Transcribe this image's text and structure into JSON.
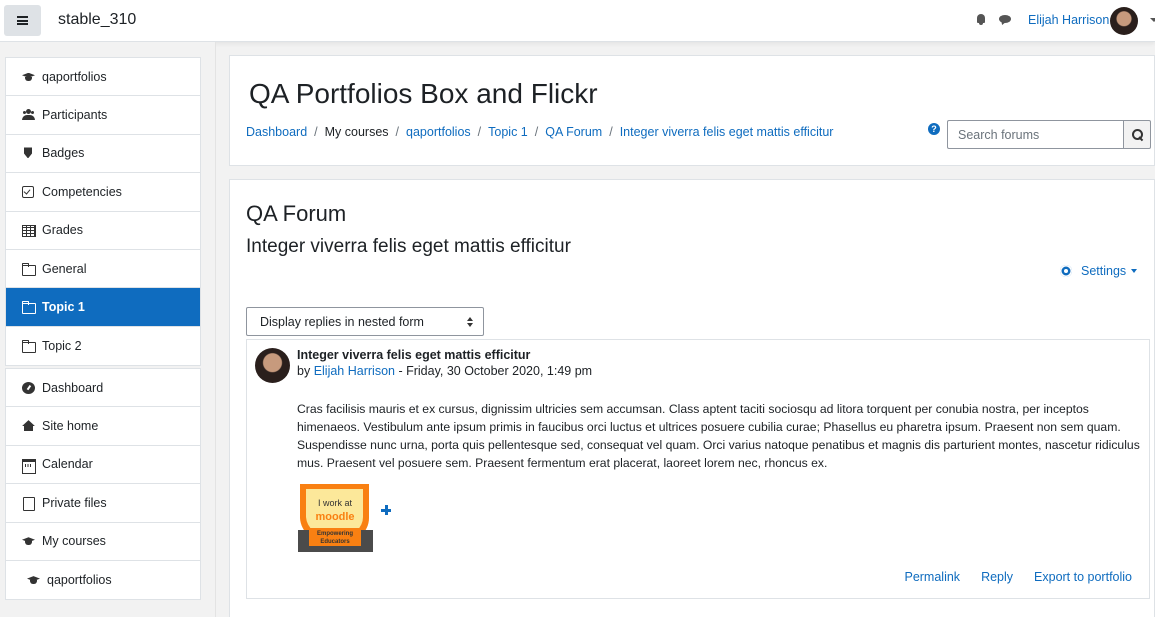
{
  "navbar": {
    "site_name": "stable_310",
    "user_name": "Elijah Harrison",
    "icons": [
      "menu-icon",
      "bell-icon",
      "message-icon",
      "avatar",
      "caret-down-icon"
    ]
  },
  "sidebar": {
    "course_group": [
      {
        "label": "qaportfolios",
        "icon": "graduation-cap-icon"
      },
      {
        "label": "Participants",
        "icon": "users-icon"
      },
      {
        "label": "Badges",
        "icon": "shield-icon"
      },
      {
        "label": "Competencies",
        "icon": "check-square-icon"
      },
      {
        "label": "Grades",
        "icon": "table-icon"
      },
      {
        "label": "General",
        "icon": "folder-icon"
      },
      {
        "label": "Topic 1",
        "icon": "folder-icon",
        "active": true
      },
      {
        "label": "Topic 2",
        "icon": "folder-icon"
      }
    ],
    "site_group": [
      {
        "label": "Dashboard",
        "icon": "dashboard-icon"
      },
      {
        "label": "Site home",
        "icon": "home-icon"
      },
      {
        "label": "Calendar",
        "icon": "calendar-icon"
      },
      {
        "label": "Private files",
        "icon": "file-icon"
      },
      {
        "label": "My courses",
        "icon": "graduation-cap-icon"
      },
      {
        "label": "qaportfolios",
        "icon": "graduation-cap-icon"
      }
    ]
  },
  "header": {
    "title": "QA Portfolios Box and Flickr",
    "breadcrumb": [
      "Dashboard",
      "My courses",
      "qaportfolios",
      "Topic 1",
      "QA Forum",
      "Integer viverra felis eget mattis efficitur"
    ],
    "search_placeholder": "Search forums"
  },
  "main": {
    "forum_name": "QA Forum",
    "discussion_name": "Integer viverra felis eget mattis efficitur",
    "settings_label": "Settings",
    "display_mode": "Display replies in nested form",
    "post": {
      "subject": "Integer viverra felis eget mattis efficitur",
      "by_prefix": "by",
      "author": "Elijah Harrison",
      "date": "- Friday, 30 October 2020, 1:49 pm",
      "body": "Cras facilisis mauris et ex cursus, dignissim ultricies sem accumsan. Class aptent taciti sociosqu ad litora torquent per conubia nostra, per inceptos himenaeos. Vestibulum ante ipsum primis in faucibus orci luctus et ultrices posuere cubilia curae; Phasellus eu pharetra ipsum. Praesent non sem quam. Suspendisse nunc urna, porta quis pellentesque sed, consequat vel quam. Orci varius natoque penatibus et magnis dis parturient montes, nascetur ridiculus mus. Praesent vel posuere sem. Praesent fermentum erat placerat, laoreet lorem nec, rhoncus ex.",
      "badge_text": [
        "I work at",
        "moodle",
        "Empowering",
        "Educators"
      ],
      "actions": [
        "Permalink",
        "Reply",
        "Export to portfolio"
      ]
    }
  },
  "colors": {
    "accent": "#0f6cbf",
    "badge_orange": "#f98012",
    "badge_yellow": "#fce89a",
    "badge_dark": "#4b4b4b"
  }
}
